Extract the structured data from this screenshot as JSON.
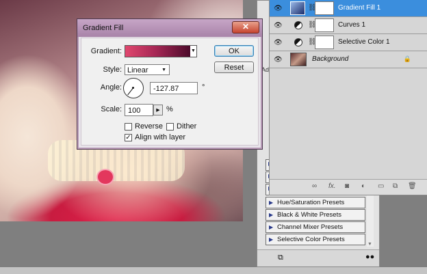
{
  "dialog": {
    "title": "Gradient Fill",
    "close_glyph": "✕",
    "gradient_label": "Gradient:",
    "style_label": "Style:",
    "style_value": "Linear",
    "angle_label": "Angle:",
    "angle_value": "-127.87",
    "angle_unit": "°",
    "scale_label": "Scale:",
    "scale_value": "100",
    "scale_unit": "%",
    "reverse_label": "Reverse",
    "reverse_checked": false,
    "dither_label": "Dither",
    "dither_checked": false,
    "align_label": "Align with layer",
    "align_checked": true,
    "ok_label": "OK",
    "reset_label": "Reset",
    "gradient_colors": [
      "#e0476e",
      "#a82856",
      "#4a0a2a"
    ]
  },
  "layers": [
    {
      "name": "Gradient Fill 1",
      "selected": true,
      "type": "gradient"
    },
    {
      "name": "Curves 1",
      "selected": false,
      "type": "adjustment"
    },
    {
      "name": "Selective Color 1",
      "selected": false,
      "type": "adjustment"
    },
    {
      "name": "Background",
      "selected": false,
      "type": "background"
    }
  ],
  "adjustments": {
    "tab_stub": "Adj",
    "presets": [
      "Hue/Saturation Presets",
      "Black & White Presets",
      "Channel Mixer Presets",
      "Selective Color Presets"
    ]
  },
  "colors": {
    "selection": "#3b8edd",
    "dialog_title": "#b48fb4"
  }
}
